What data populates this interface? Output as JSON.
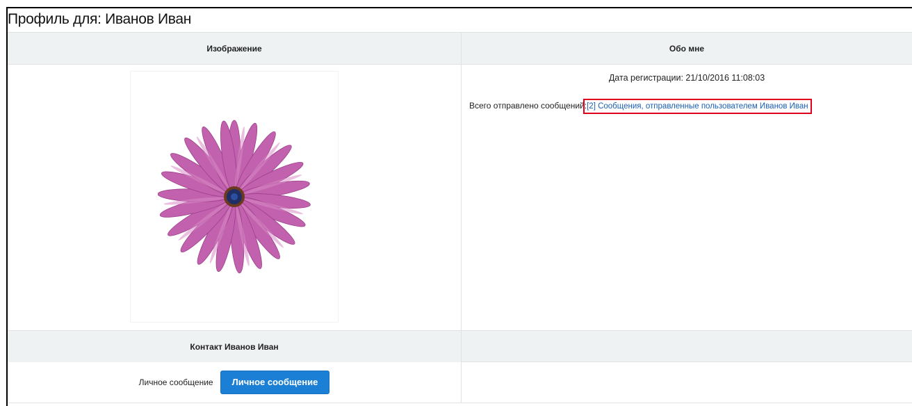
{
  "page": {
    "title": "Профиль для: Иванов Иван"
  },
  "table": {
    "col1_header": "Изображение",
    "col2_header": "Обо мне"
  },
  "about": {
    "registration": "Дата регистрации: 21/10/2016 11:08:03",
    "messages_label": "Всего отправлено сообщений:",
    "messages_link": "[2] Сообщения, отправленные пользователем Иванов Иван"
  },
  "contact": {
    "header": "Контакт Иванов Иван",
    "pm_label": "Личное сообщение",
    "pm_button": "Личное сообщение"
  },
  "colors": {
    "accent": "#1c7fd6",
    "link": "#1a5fb4",
    "highlight": "#e0001b",
    "header_bg": "#eef2f3",
    "petal": "#c565b0"
  },
  "icons": {
    "avatar": "daisy-flower-image"
  }
}
